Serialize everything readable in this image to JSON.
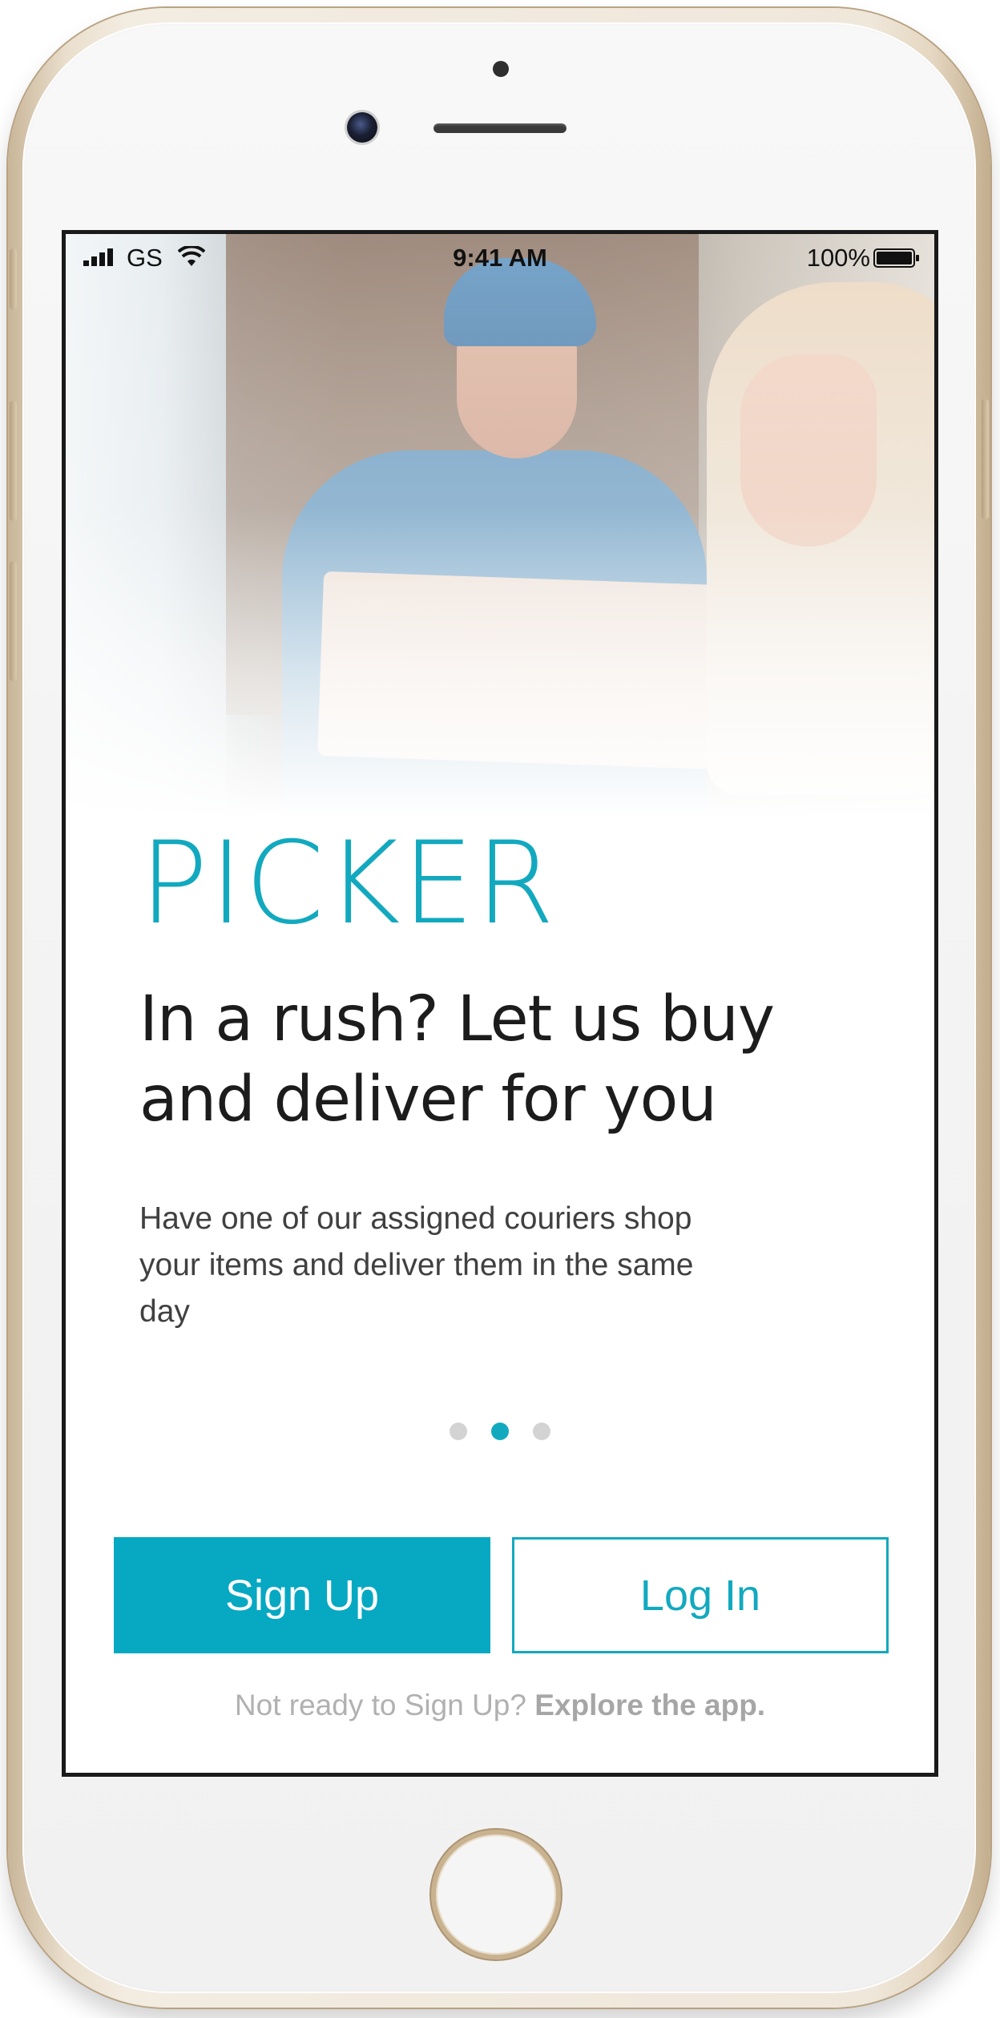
{
  "status_bar": {
    "carrier": "GS",
    "time": "9:41 AM",
    "battery": "100%"
  },
  "icons": {
    "signal": "signal-bars-icon",
    "wifi": "wifi-icon",
    "battery": "battery-full-icon"
  },
  "colors": {
    "brand": "#12a9bf",
    "primary_button": "#07a8c2",
    "inactive_dot": "#d3d3d3",
    "muted_text": "#b1b1b1"
  },
  "onboarding": {
    "brand": "PICKER",
    "headline": "In a rush? Let us buy and deliver for you",
    "description": "Have one of our assigned couriers shop your items and deliver them in the same day",
    "pagination": {
      "total": 3,
      "active_index": 1
    }
  },
  "actions": {
    "signup_label": "Sign Up",
    "login_label": "Log In",
    "explore_prefix": "Not ready to Sign Up?",
    "explore_link": "Explore the app."
  }
}
